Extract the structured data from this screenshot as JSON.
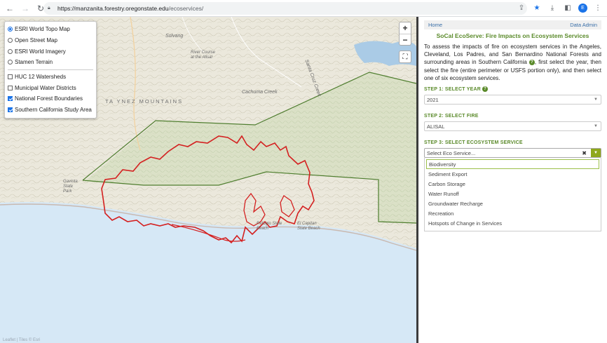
{
  "browser": {
    "url_host": "https://manzanita.forestry.oregonstate.edu",
    "url_path": "/ecoservices/",
    "avatar_letter": "E"
  },
  "map": {
    "layers": [
      {
        "label": "ESRI World Topo Map",
        "type": "radio",
        "checked": true
      },
      {
        "label": "Open Street Map",
        "type": "radio",
        "checked": false
      },
      {
        "label": "ESRI World Imagery",
        "type": "radio",
        "checked": false
      },
      {
        "label": "Stamen Terrain",
        "type": "radio",
        "checked": false
      },
      {
        "label": "HUC 12 Watersheds",
        "type": "check",
        "checked": false
      },
      {
        "label": "Municipal Water Districts",
        "type": "check",
        "checked": false
      },
      {
        "label": "National Forest Boundaries",
        "type": "check",
        "checked": true
      },
      {
        "label": "Southern California Study Area",
        "type": "check",
        "checked": true
      }
    ],
    "zoom_in": "+",
    "zoom_out": "−",
    "labels": {
      "solvang": "Solvang",
      "river_course": "River Course at the Alisal",
      "santa_ynez_mtns": "TA YNEZ MOUNTAINS",
      "gaviota_state_park": "Gaviota State Park",
      "refugio_state_beach": "Refugio State Beach",
      "el_capitan": "El Capitan State Beach",
      "cachuma": "Cachuma Creek",
      "santa_cruz_creek": "Santa Cruz Creek"
    },
    "attribution": "Leaflet | Tiles © Esri"
  },
  "panel": {
    "home": "Home",
    "data_admin": "Data Admin",
    "title": "SoCal EcoServe: Fire Impacts on Ecosystem Services",
    "intro_a": "To assess the impacts of fire on ecosystem services in the Angeles, Cleveland, Los Padres, and San Bernardino National Forests and surrounding areas in Southern California ",
    "intro_b": ", first select the year, then select the fire (entire perimeter or USFS portion only), and then select one of six ecosystem services.",
    "step1": "STEP 1: SELECT YEAR",
    "year": "2021",
    "step2": "STEP 2: SELECT FIRE",
    "fire": "ALISAL",
    "step3": "STEP 3: SELECT ECOSYSTEM SERVICE",
    "eco_placeholder": "Select Eco Service...",
    "options": [
      "Biodiversity",
      "Sediment Export",
      "Carbon Storage",
      "Water Runoff",
      "Groundwater Recharge",
      "Recreation",
      "Hotspots of Change in Services"
    ],
    "colors": {
      "accent_green": "#5a8a2a",
      "fire_red": "#d42020",
      "forest_green": "#4a7a2a"
    }
  }
}
